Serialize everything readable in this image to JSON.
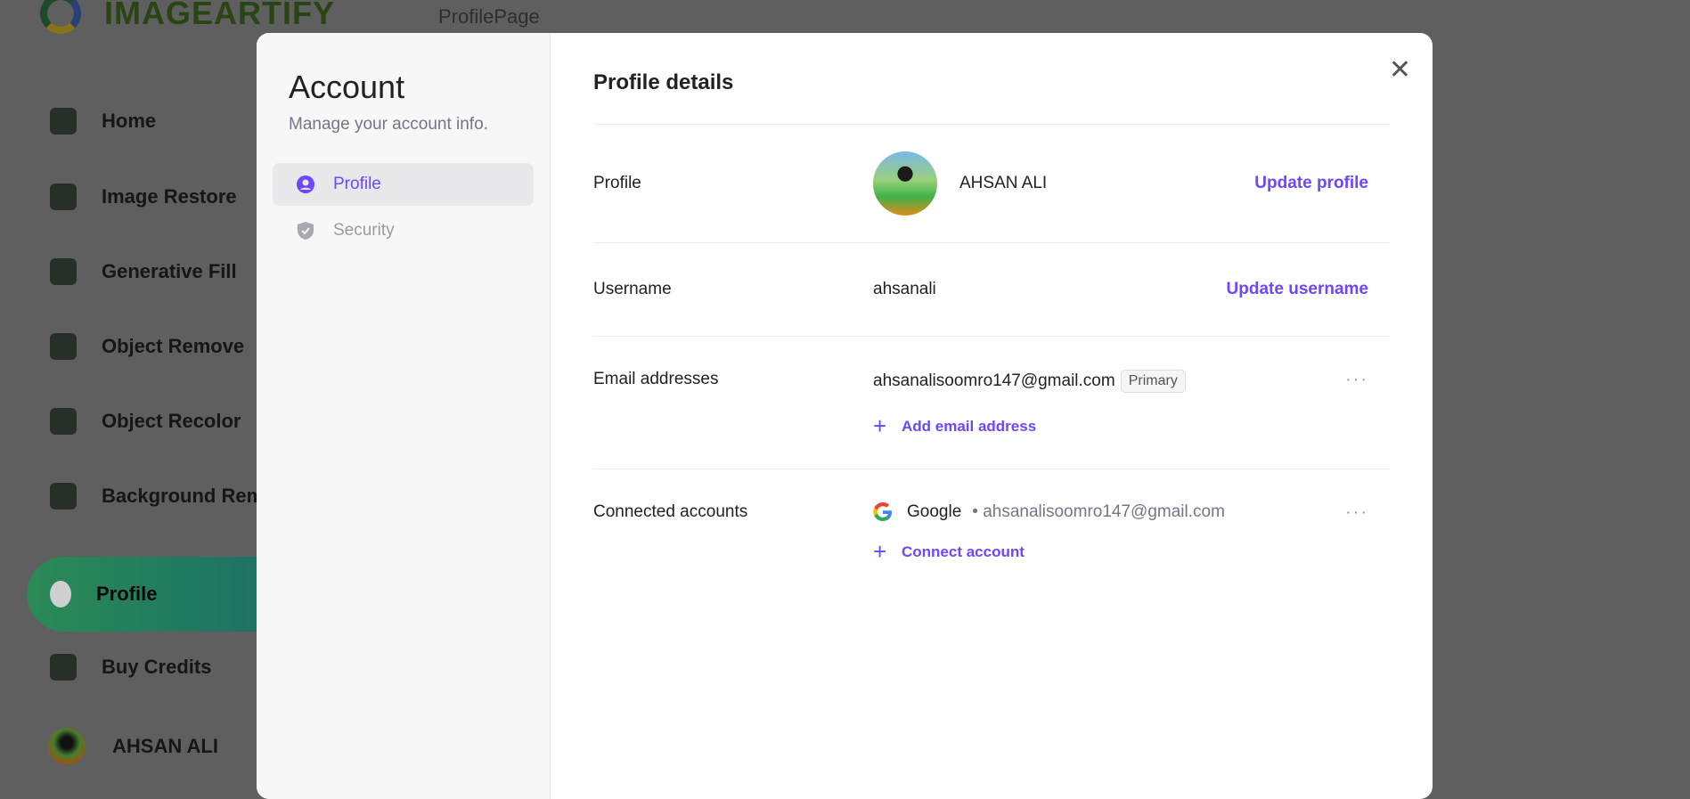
{
  "app": {
    "brand": "IMAGEARTIFY",
    "page": "ProfilePage"
  },
  "sidebar": {
    "items": [
      {
        "label": "Home"
      },
      {
        "label": "Image Restore"
      },
      {
        "label": "Generative Fill"
      },
      {
        "label": "Object Remove"
      },
      {
        "label": "Object Recolor"
      },
      {
        "label": "Background Remove"
      },
      {
        "label": "Profile",
        "active": true
      },
      {
        "label": "Buy Credits"
      }
    ],
    "user": "AHSAN ALI"
  },
  "modal": {
    "title": "Account",
    "subtitle": "Manage your account info.",
    "nav": [
      {
        "label": "Profile",
        "icon": "user-circle-icon",
        "active": true
      },
      {
        "label": "Security",
        "icon": "shield-check-icon"
      }
    ],
    "section_title": "Profile details",
    "profile": {
      "label": "Profile",
      "name": "AHSAN ALI",
      "action": "Update profile"
    },
    "username": {
      "label": "Username",
      "value": "ahsanali",
      "action": "Update username"
    },
    "email": {
      "label": "Email addresses",
      "value": "ahsanalisoomro147@gmail.com",
      "badge": "Primary",
      "add": "Add email address"
    },
    "connected": {
      "label": "Connected accounts",
      "provider": "Google",
      "email": "• ahsanalisoomro147@gmail.com",
      "add": "Connect account"
    },
    "accent": "#6c47ff"
  }
}
